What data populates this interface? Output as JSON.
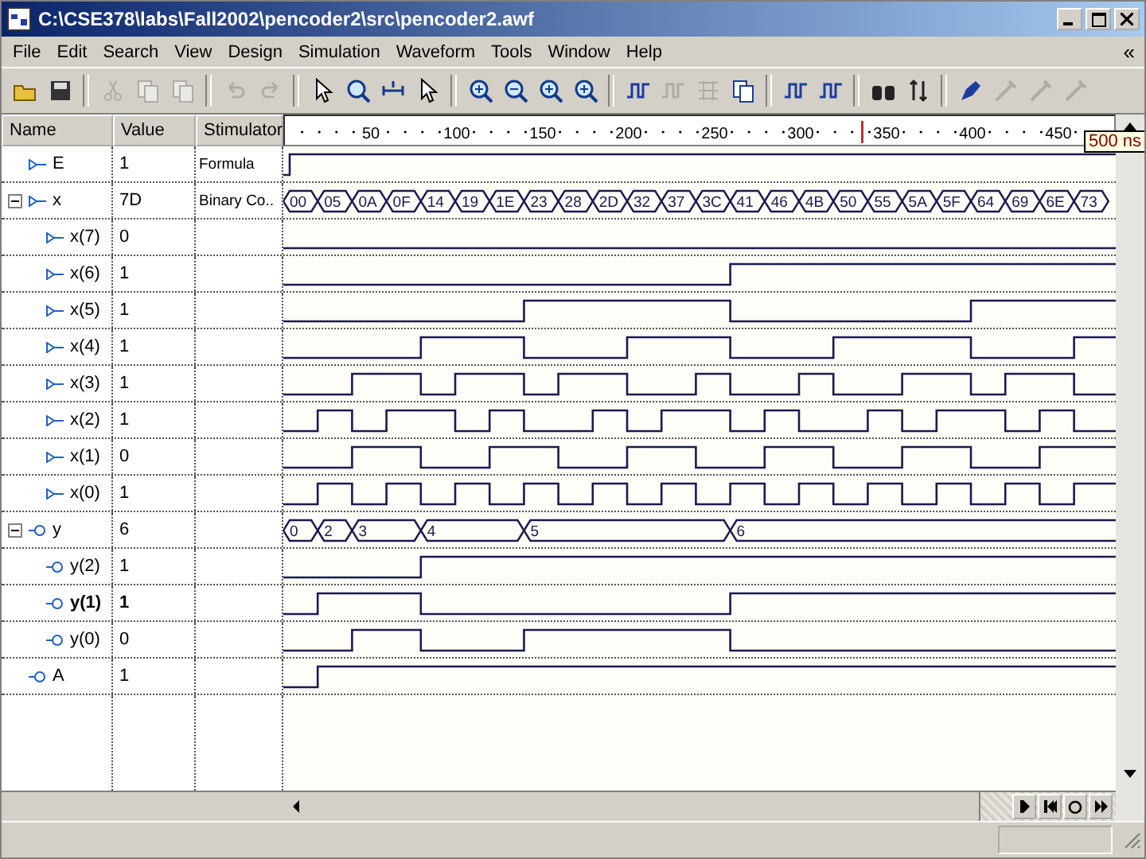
{
  "window": {
    "title": "C:\\CSE378\\labs\\Fall2002\\pencoder2\\src\\pencoder2.awf"
  },
  "menu": [
    "File",
    "Edit",
    "Search",
    "View",
    "Design",
    "Simulation",
    "Waveform",
    "Tools",
    "Window",
    "Help"
  ],
  "menu_chevron": "«",
  "toolbar": [
    {
      "disabled": false
    },
    {
      "disabled": false
    },
    {
      "disabled": true
    },
    {
      "disabled": true
    },
    {
      "disabled": true
    },
    {
      "disabled": true
    },
    {
      "disabled": true
    },
    {
      "disabled": false
    },
    {
      "disabled": false
    },
    {
      "disabled": false
    },
    {
      "disabled": false
    },
    {
      "disabled": false
    },
    {
      "disabled": false
    },
    {
      "disabled": false
    },
    {
      "disabled": false
    },
    {
      "disabled": false
    },
    {
      "disabled": true
    },
    {
      "disabled": true
    },
    {
      "disabled": false
    },
    {
      "disabled": false
    },
    {
      "disabled": false
    },
    {
      "disabled": false
    },
    {
      "disabled": false
    },
    {
      "disabled": false
    },
    {
      "disabled": true
    },
    {
      "disabled": true
    },
    {
      "disabled": true
    }
  ],
  "columns": [
    "Name",
    "Value",
    "Stimulator"
  ],
  "ruler": {
    "labels": [
      "50",
      "100",
      "150",
      "200",
      "250",
      "300",
      "350",
      "400",
      "450"
    ],
    "tooltip": "500 ns"
  },
  "signals": [
    {
      "name": "E",
      "value": "1",
      "stimulator": "Formula",
      "kind": "input",
      "selected": false
    },
    {
      "name": "x",
      "value": "7D",
      "stimulator": "Binary Co..",
      "kind": "input",
      "selected": false,
      "expanded": true,
      "segments": [
        "00",
        "05",
        "0A",
        "0F",
        "14",
        "19",
        "1E",
        "23",
        "28",
        "2D",
        "32",
        "37",
        "3C",
        "41",
        "46",
        "4B",
        "50",
        "55",
        "5A",
        "5F",
        "64",
        "69",
        "6E",
        "73"
      ],
      "children": [
        {
          "name": "x(7)",
          "value": "0",
          "kind": "input",
          "selected": false
        },
        {
          "name": "x(6)",
          "value": "1",
          "kind": "input",
          "selected": false
        },
        {
          "name": "x(5)",
          "value": "1",
          "kind": "input",
          "selected": false
        },
        {
          "name": "x(4)",
          "value": "1",
          "kind": "input",
          "selected": false
        },
        {
          "name": "x(3)",
          "value": "1",
          "kind": "input",
          "selected": false
        },
        {
          "name": "x(2)",
          "value": "1",
          "kind": "input",
          "selected": false
        },
        {
          "name": "x(1)",
          "value": "0",
          "kind": "input",
          "selected": false
        },
        {
          "name": "x(0)",
          "value": "1",
          "kind": "input",
          "selected": false
        }
      ]
    },
    {
      "name": "y",
      "value": "6",
      "kind": "output",
      "selected": false,
      "expanded": true,
      "segments": [
        "0",
        "2",
        "3",
        "4",
        "5",
        "6"
      ],
      "children": [
        {
          "name": "y(2)",
          "value": "1",
          "kind": "output",
          "selected": false
        },
        {
          "name": "y(1)",
          "value": "1",
          "kind": "output",
          "selected": true
        },
        {
          "name": "y(0)",
          "value": "0",
          "kind": "output",
          "selected": false
        }
      ]
    },
    {
      "name": "A",
      "value": "1",
      "kind": "output",
      "selected": false
    }
  ]
}
